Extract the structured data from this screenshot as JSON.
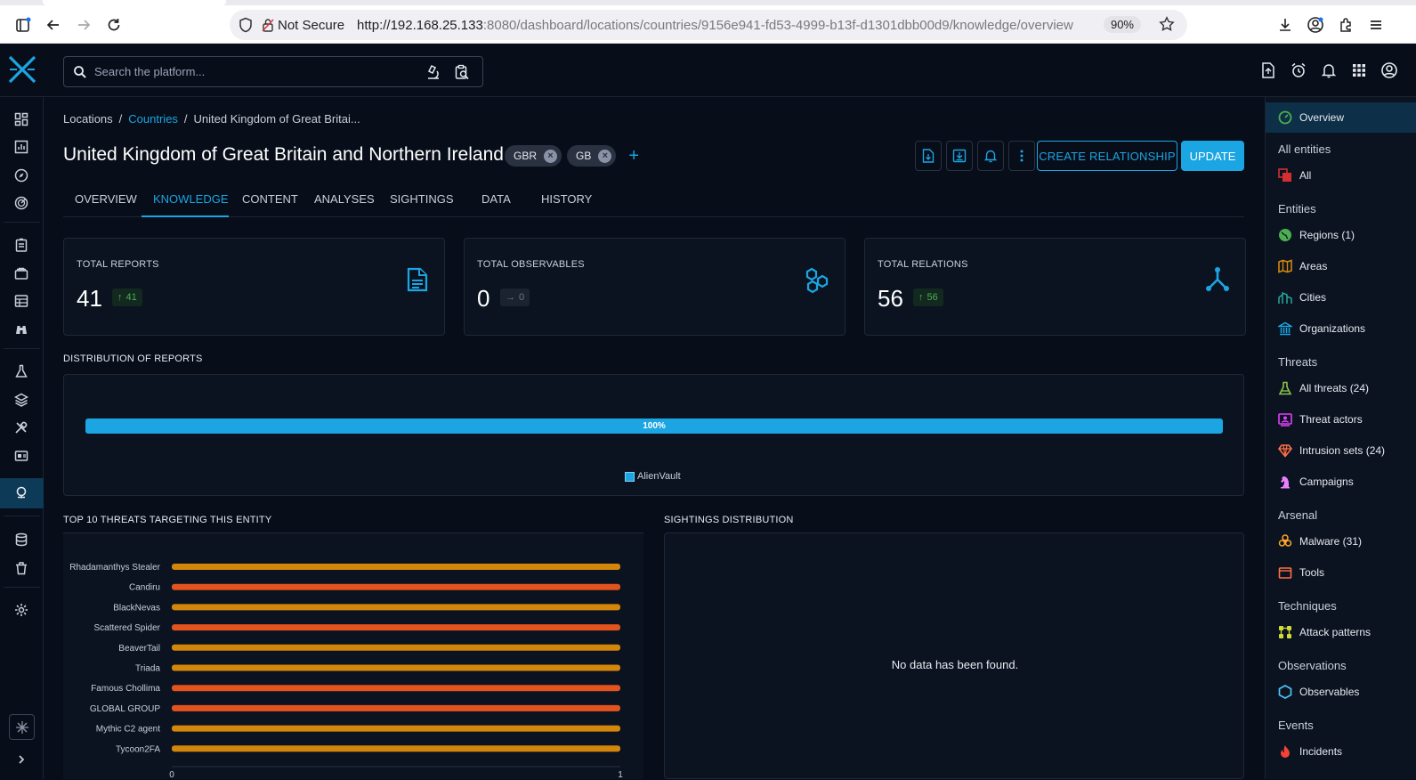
{
  "browser": {
    "security_label": "Not Secure",
    "url_host": "http://192.168.25.133",
    "url_rest": ":8080/dashboard/locations/countries/9156e941-fd53-4999-b13f-d1301dbb00d9/knowledge/overview",
    "zoom": "90%"
  },
  "search": {
    "placeholder": "Search the platform..."
  },
  "breadcrumb": {
    "root": "Locations",
    "parent": "Countries",
    "current": "United Kingdom of Great Britai..."
  },
  "entity": {
    "title": "United Kingdom of Great Britain and Northern Ireland",
    "chips": [
      "GBR",
      "GB"
    ]
  },
  "buttons": {
    "create_relationship": "CREATE RELATIONSHIP",
    "update": "UPDATE"
  },
  "tabs": [
    "OVERVIEW",
    "KNOWLEDGE",
    "CONTENT",
    "ANALYSES",
    "SIGHTINGS",
    "DATA",
    "HISTORY"
  ],
  "cards": [
    {
      "label": "TOTAL REPORTS",
      "value": "41",
      "delta": "41",
      "icon": "report-icon"
    },
    {
      "label": "TOTAL OBSERVABLES",
      "value": "0",
      "delta": "0",
      "icon": "observables-icon"
    },
    {
      "label": "TOTAL RELATIONS",
      "value": "56",
      "delta": "56",
      "icon": "relations-icon"
    }
  ],
  "distribution": {
    "title": "DISTRIBUTION OF REPORTS",
    "bar_label": "100%",
    "legend": "AlienVault",
    "color": "#1ba6e3"
  },
  "threats": {
    "title": "TOP 10 THREATS TARGETING THIS ENTITY",
    "axis_ticks": [
      "0",
      "1"
    ]
  },
  "chart_data": {
    "type": "bar",
    "orientation": "horizontal",
    "categories": [
      "Rhadamanthys Stealer",
      "Candiru",
      "BlackNevas",
      "Scattered Spider",
      "BeaverTail",
      "Triada",
      "Famous Chollima",
      "GLOBAL GROUP",
      "Mythic C2 agent",
      "Tycoon2FA"
    ],
    "values": [
      1,
      1,
      1,
      1,
      1,
      1,
      1,
      1,
      1,
      1
    ],
    "colors": [
      "#d4860b",
      "#e2531d",
      "#d4860b",
      "#e2531d",
      "#d4860b",
      "#d4860b",
      "#e2531d",
      "#e2531d",
      "#d4860b",
      "#d4860b"
    ],
    "xlim": [
      0,
      1
    ]
  },
  "sightings": {
    "title": "SIGHTINGS DISTRIBUTION",
    "empty": "No data has been found."
  },
  "right_panel": {
    "overview": "Overview",
    "groups": [
      {
        "header": "All entities",
        "items": [
          {
            "label": "All",
            "icon": "all-entities-icon",
            "color": "#d32f2f"
          }
        ]
      },
      {
        "header": "Entities",
        "items": [
          {
            "label": "Regions (1)",
            "icon": "globe-icon",
            "color": "#4caf50"
          },
          {
            "label": "Areas",
            "icon": "map-icon",
            "color": "#d4860b"
          },
          {
            "label": "Cities",
            "icon": "city-icon",
            "color": "#26a69a"
          },
          {
            "label": "Organizations",
            "icon": "bank-icon",
            "color": "#1ba6e3"
          }
        ]
      },
      {
        "header": "Threats",
        "items": [
          {
            "label": "All threats (24)",
            "icon": "flask-icon",
            "color": "#8bc34a"
          },
          {
            "label": "Threat actors",
            "icon": "threat-actor-icon",
            "color": "#e040fb"
          },
          {
            "label": "Intrusion sets (24)",
            "icon": "diamond-icon",
            "color": "#ff7043"
          },
          {
            "label": "Campaigns",
            "icon": "chess-knight-icon",
            "color": "#ea80fc"
          }
        ]
      },
      {
        "header": "Arsenal",
        "items": [
          {
            "label": "Malware (31)",
            "icon": "biohazard-icon",
            "color": "#ffa726"
          },
          {
            "label": "Tools",
            "icon": "tools-icon",
            "color": "#ff7043"
          }
        ]
      },
      {
        "header": "Techniques",
        "items": [
          {
            "label": "Attack patterns",
            "icon": "attack-pattern-icon",
            "color": "#cddc39"
          }
        ]
      },
      {
        "header": "Observations",
        "items": [
          {
            "label": "Observables",
            "icon": "hexagon-icon",
            "color": "#4fc3f7"
          }
        ]
      },
      {
        "header": "Events",
        "items": [
          {
            "label": "Incidents",
            "icon": "fire-icon",
            "color": "#f44336"
          }
        ]
      }
    ]
  }
}
